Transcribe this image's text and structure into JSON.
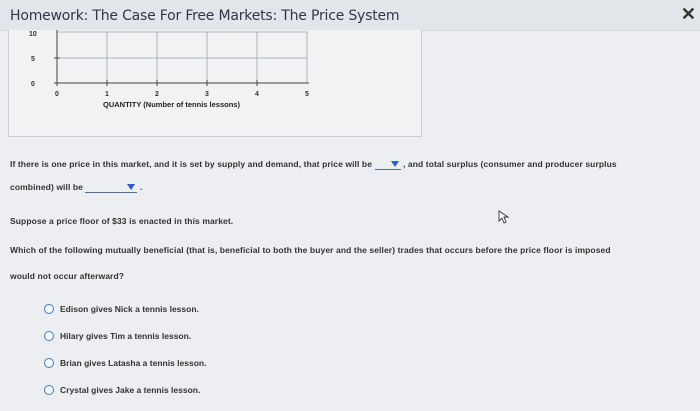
{
  "window": {
    "title": "Homework: The Case For Free Markets: The Price System",
    "close_symbol": "✕"
  },
  "graph": {
    "y_ticks": [
      "10",
      "5",
      "0"
    ],
    "x_ticks": [
      "0",
      "1",
      "2",
      "3",
      "4",
      "5"
    ],
    "x_axis_label": "QUANTITY (Number of tennis lessons)"
  },
  "question1": {
    "part1": "If there is one price in this market, and it is set by supply and demand, that price will be",
    "part2": ", and total surplus (consumer and producer surplus",
    "part3": "combined) will be",
    "part4": "."
  },
  "scenario": {
    "text": "Suppose a price floor of $33 is enacted in this market."
  },
  "question2": {
    "line1": "Which of the following mutually beneficial (that is, beneficial to both the buyer and the seller) trades that occurs before the price floor is imposed",
    "line2": "would not occur afterward?"
  },
  "options": [
    "Edison gives Nick a tennis lesson.",
    "Hilary gives Tim a tennis lesson.",
    "Brian gives Latasha a tennis lesson.",
    "Crystal gives Jake a tennis lesson."
  ],
  "colors": {
    "accent": "#2860c8",
    "radio_border": "#3a7ad0"
  }
}
